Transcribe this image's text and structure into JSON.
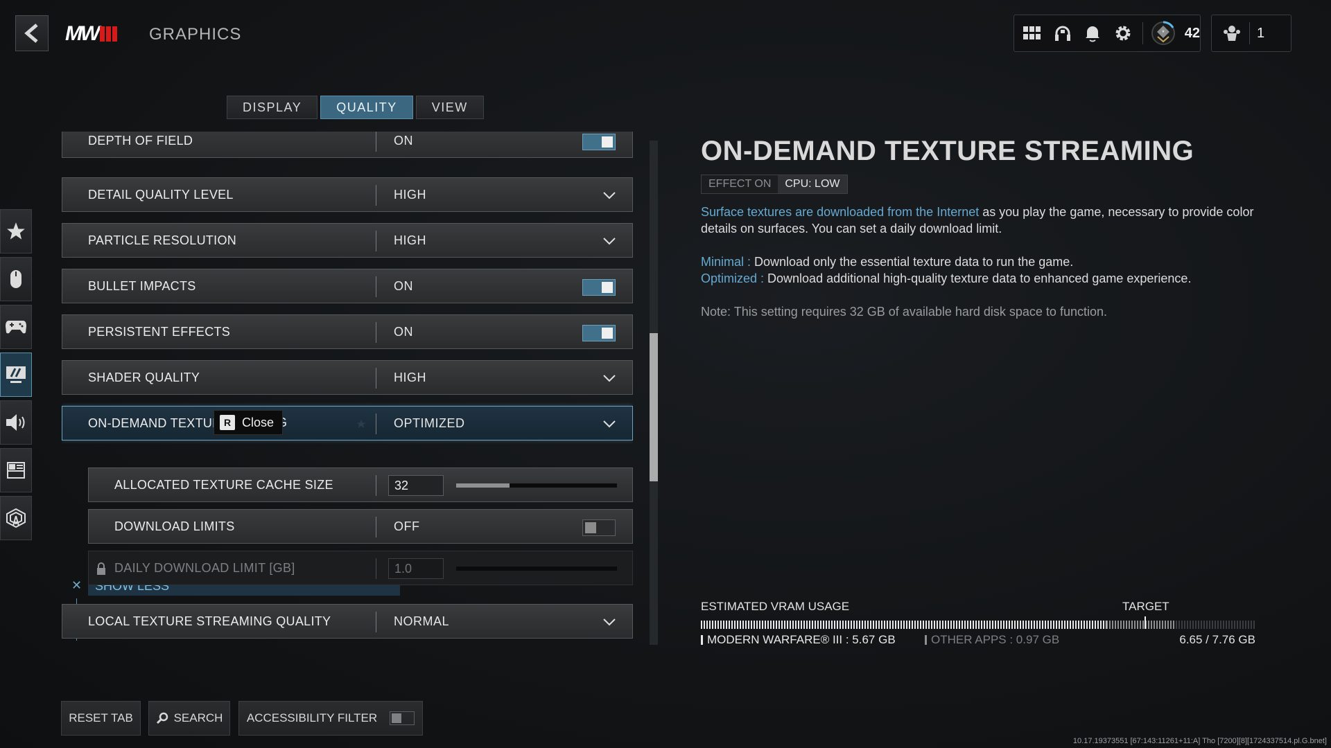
{
  "header": {
    "back_label": "Back",
    "logo_text": "MW",
    "title": "GRAPHICS",
    "hud": {
      "icons": [
        "apps-grid-icon",
        "headset-icon",
        "bell-icon",
        "gear-icon"
      ],
      "rank_level": "42",
      "party_count": "1"
    }
  },
  "tabs": [
    {
      "label": "DISPLAY",
      "active": false
    },
    {
      "label": "QUALITY",
      "active": true
    },
    {
      "label": "VIEW",
      "active": false
    }
  ],
  "sidebar": {
    "items": [
      {
        "name": "favorites",
        "icon": "star-icon",
        "active": false
      },
      {
        "name": "mouse",
        "icon": "mouse-icon",
        "active": false
      },
      {
        "name": "controller",
        "icon": "gamepad-icon",
        "active": false
      },
      {
        "name": "graphics",
        "icon": "monitor-icon",
        "active": true
      },
      {
        "name": "audio",
        "icon": "speaker-icon",
        "active": false
      },
      {
        "name": "interface",
        "icon": "layout-icon",
        "active": false
      },
      {
        "name": "network",
        "icon": "network-tower-icon",
        "active": false
      }
    ]
  },
  "settings": {
    "depth_of_field": {
      "label": "DEPTH OF FIELD",
      "value": "ON",
      "toggle": true
    },
    "detail_quality": {
      "label": "DETAIL QUALITY LEVEL",
      "value": "HIGH"
    },
    "particle_resolution": {
      "label": "PARTICLE RESOLUTION",
      "value": "HIGH"
    },
    "bullet_impacts": {
      "label": "BULLET IMPACTS",
      "value": "ON",
      "toggle": true
    },
    "persistent_effects": {
      "label": "PERSISTENT EFFECTS",
      "value": "ON",
      "toggle": true
    },
    "shader_quality": {
      "label": "SHADER QUALITY",
      "value": "HIGH"
    },
    "on_demand": {
      "label": "ON-DEMAND TEXTURE STREAMING",
      "label_visible": "ON-DEMAND TEXTURE",
      "label_tail": "G",
      "value": "OPTIMIZED"
    },
    "show_less": "SHOW LESS",
    "cache_size": {
      "label": "ALLOCATED TEXTURE CACHE SIZE",
      "value": "32",
      "slider_fraction": 0.33
    },
    "download_limits": {
      "label": "DOWNLOAD LIMITS",
      "value": "OFF",
      "toggle": false
    },
    "daily_limit": {
      "label": "DAILY DOWNLOAD LIMIT [GB]",
      "value": "1.0",
      "slider_fraction": 0,
      "locked": true
    },
    "local_streaming": {
      "label": "LOCAL TEXTURE STREAMING QUALITY",
      "value": "NORMAL"
    }
  },
  "tooltip": {
    "key": "R",
    "label": "Close"
  },
  "bottom": {
    "reset_label": "RESET TAB",
    "search_label": "SEARCH",
    "accessibility_label": "ACCESSIBILITY FILTER",
    "accessibility_on": false
  },
  "detail": {
    "title": "ON-DEMAND TEXTURE STREAMING",
    "badge_effect": "EFFECT ON",
    "badge_cpu": "CPU: LOW",
    "para1_highlight": "Surface textures are downloaded from the Internet",
    "para1_rest": " as you play the game, necessary to provide color details on surfaces. You can set a daily download limit.",
    "minimal_label": "Minimal :",
    "minimal_text": " Download only the essential texture data to run the game.",
    "optimized_label": "Optimized :",
    "optimized_text": " Download additional high-quality texture data to enhanced game experience.",
    "note": "Note: This setting requires 32 GB of available hard disk space to function."
  },
  "vram": {
    "title": "ESTIMATED VRAM USAGE",
    "target_label": "TARGET",
    "game_label": "MODERN WARFARE® III : 5.67 GB",
    "other_label": "OTHER APPS : 0.97 GB",
    "total_label": "6.65 / 7.76 GB",
    "game_gb": 5.67,
    "other_gb": 0.97,
    "total_gb": 7.76,
    "target_fraction": 0.8,
    "colors": {
      "game": "#e8e8e8",
      "other": "#8e9092"
    }
  },
  "build_info": "10.17.19373551 [67:143:11261+11:A] Tho [7200][8][1724337514.pl.G.bnet]"
}
